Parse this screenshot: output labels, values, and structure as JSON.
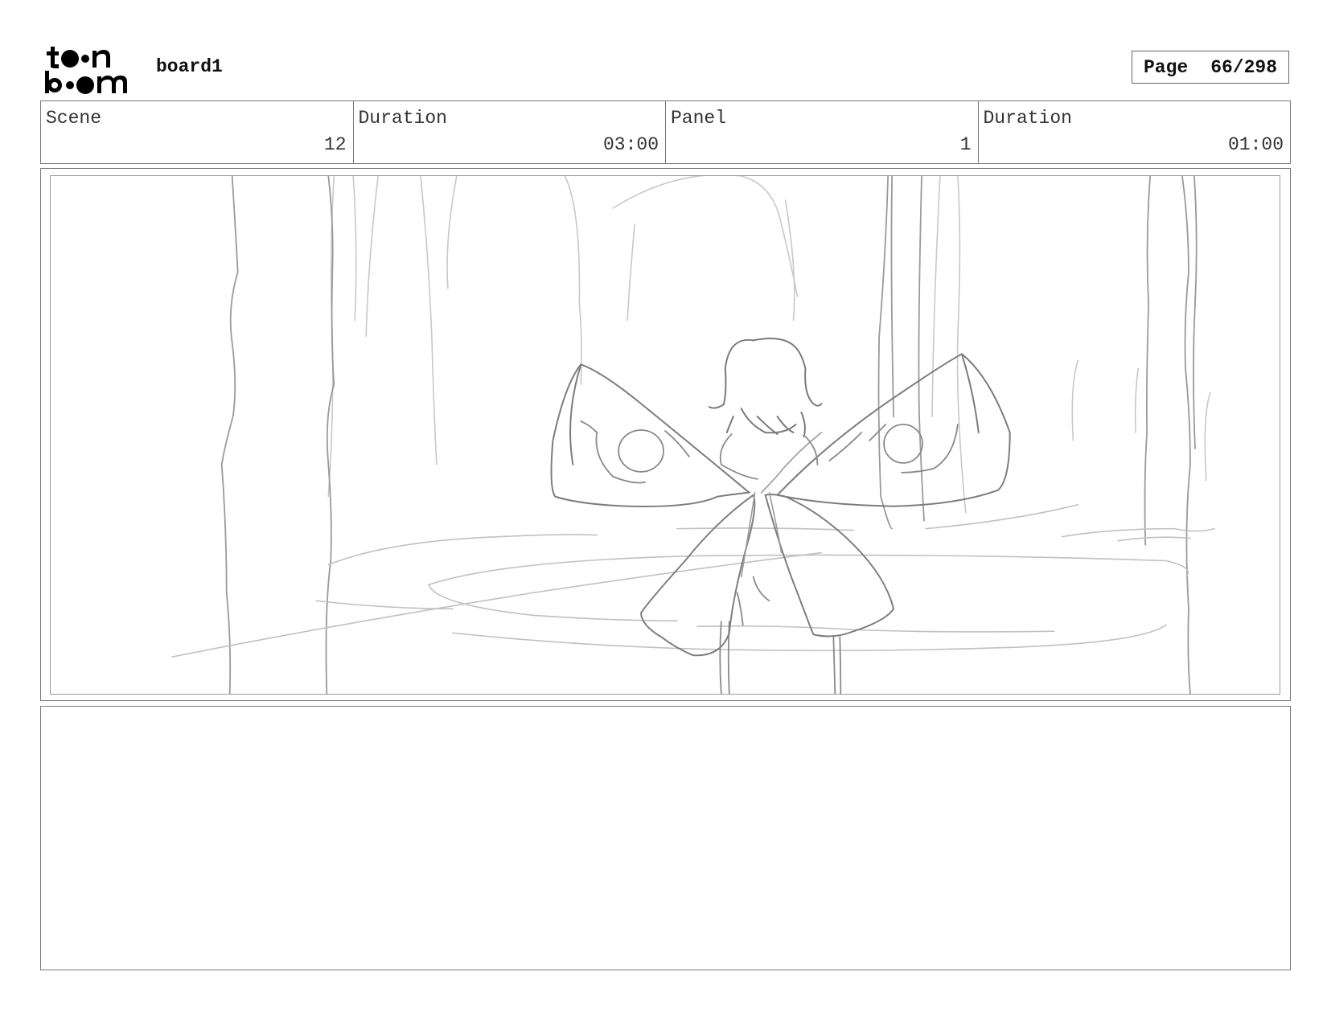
{
  "header": {
    "logo_text": [
      "toon",
      "boom"
    ],
    "project_title": "board1",
    "page_label": "Page",
    "page_number": "66/298"
  },
  "info": [
    {
      "label": "Scene",
      "value": "12"
    },
    {
      "label": "Duration",
      "value": "03:00"
    },
    {
      "label": "Panel",
      "value": "1"
    },
    {
      "label": "Duration",
      "value": "01:00"
    }
  ],
  "panel": {
    "image": "pencil-sketch-fairy-with-wings-in-forest-glade"
  },
  "notes": {
    "text": ""
  }
}
